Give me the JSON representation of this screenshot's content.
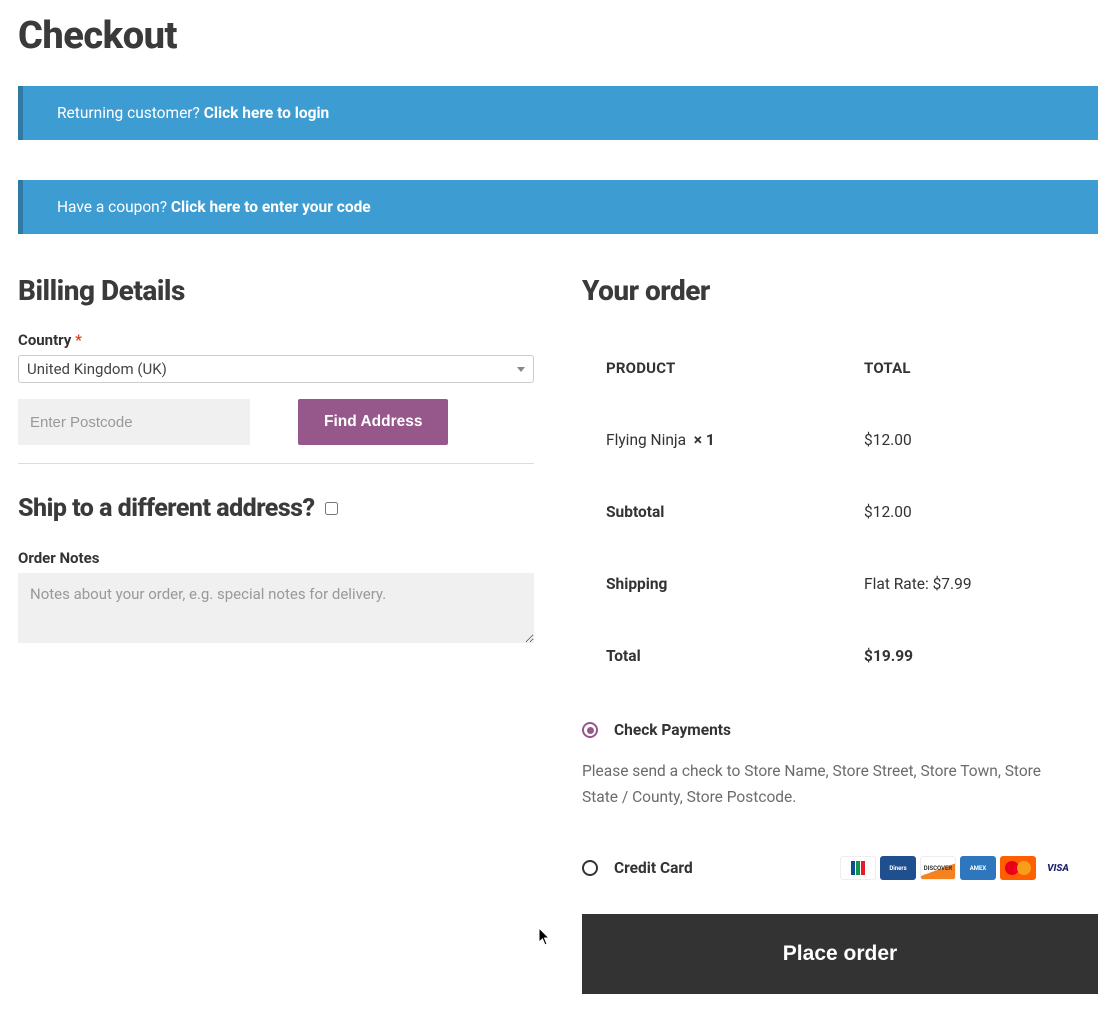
{
  "page": {
    "title": "Checkout"
  },
  "notices": {
    "returning_text": "Returning customer? ",
    "returning_link": "Click here to login",
    "coupon_text": "Have a coupon? ",
    "coupon_link": "Click here to enter your code"
  },
  "billing": {
    "heading": "Billing Details",
    "country_label": "Country",
    "required_mark": "*",
    "country_value": "United Kingdom (UK)",
    "postcode_placeholder": "Enter Postcode",
    "find_address_label": "Find Address"
  },
  "shipping": {
    "heading": "Ship to a different address?",
    "checked": false,
    "order_notes_label": "Order Notes",
    "order_notes_placeholder": "Notes about your order, e.g. special notes for delivery."
  },
  "order": {
    "heading": "Your order",
    "headers": {
      "product": "PRODUCT",
      "total": "TOTAL"
    },
    "items": [
      {
        "name": "Flying Ninja",
        "qty": "× 1",
        "total": "$12.00"
      }
    ],
    "subtotal_label": "Subtotal",
    "subtotal_value": "$12.00",
    "shipping_label": "Shipping",
    "shipping_value": "Flat Rate: $7.99",
    "total_label": "Total",
    "total_value": "$19.99"
  },
  "payment": {
    "check": {
      "label": "Check Payments",
      "selected": true,
      "description": "Please send a check to Store Name, Store Street, Store Town, Store State / County, Store Postcode."
    },
    "credit": {
      "label": "Credit Card",
      "selected": false,
      "cards": [
        "jcb",
        "diners",
        "discover",
        "amex",
        "mastercard",
        "visa"
      ]
    },
    "place_order_label": "Place order"
  }
}
